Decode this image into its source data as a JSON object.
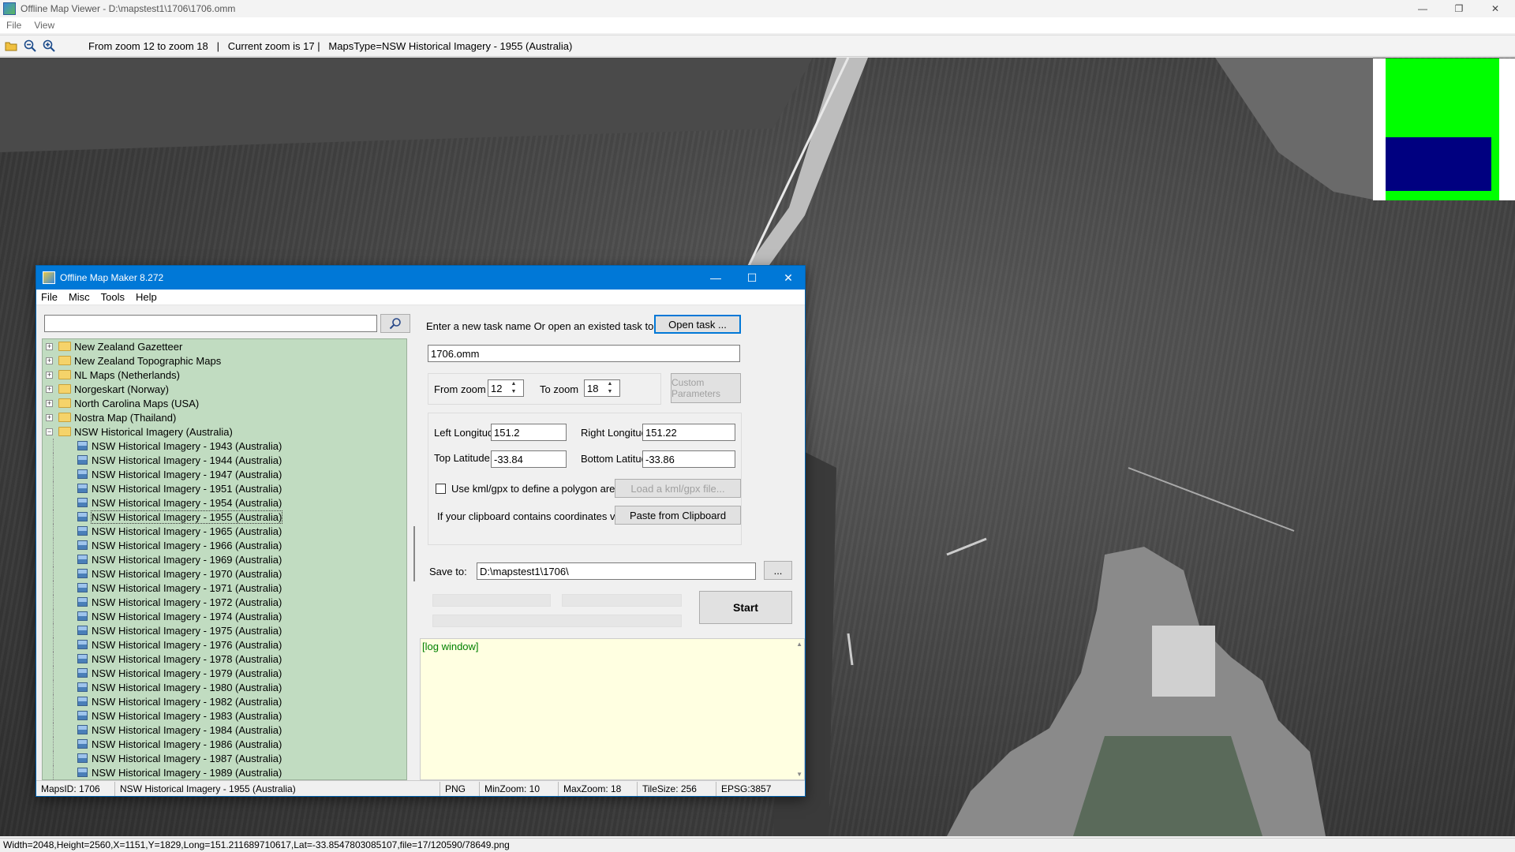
{
  "viewer": {
    "title": "Offline Map Viewer - D:\\mapstest1\\1706\\1706.omm",
    "menu": [
      "File",
      "View"
    ],
    "toolbar_info": "From zoom 12 to zoom 18   |   Current zoom is 17 |   MapsType=NSW Historical Imagery - 1955 (Australia)",
    "window_controls": {
      "minimize": "—",
      "restore": "❐",
      "close": "✕"
    },
    "status": "Width=2048,Height=2560,X=1151,Y=1829,Long=151.211689710617,Lat=-33.8547803085107,file=17/120590/78649.png"
  },
  "dialog": {
    "title": "Offline Map Maker 8.272",
    "menu": [
      "File",
      "Misc",
      "Tools",
      "Help"
    ],
    "search": {
      "value": "",
      "placeholder": ""
    },
    "tree": {
      "folders": [
        {
          "label": "New Zealand Gazetteer",
          "expander": "+"
        },
        {
          "label": "New Zealand Topographic Maps",
          "expander": "+"
        },
        {
          "label": "NL Maps (Netherlands)",
          "expander": "+"
        },
        {
          "label": "Norgeskart (Norway)",
          "expander": "+"
        },
        {
          "label": "North Carolina Maps (USA)",
          "expander": "+"
        },
        {
          "label": "Nostra Map (Thailand)",
          "expander": "+"
        },
        {
          "label": "NSW Historical Imagery (Australia)",
          "expander": "−"
        }
      ],
      "children": [
        "NSW Historical Imagery - 1943 (Australia)",
        "NSW Historical Imagery - 1944 (Australia)",
        "NSW Historical Imagery - 1947 (Australia)",
        "NSW Historical Imagery - 1951 (Australia)",
        "NSW Historical Imagery - 1954 (Australia)",
        "NSW Historical Imagery - 1955 (Australia)",
        "NSW Historical Imagery - 1965 (Australia)",
        "NSW Historical Imagery - 1966 (Australia)",
        "NSW Historical Imagery - 1969 (Australia)",
        "NSW Historical Imagery - 1970 (Australia)",
        "NSW Historical Imagery - 1971 (Australia)",
        "NSW Historical Imagery - 1972 (Australia)",
        "NSW Historical Imagery - 1974 (Australia)",
        "NSW Historical Imagery - 1975 (Australia)",
        "NSW Historical Imagery - 1976 (Australia)",
        "NSW Historical Imagery - 1978 (Australia)",
        "NSW Historical Imagery - 1979 (Australia)",
        "NSW Historical Imagery - 1980 (Australia)",
        "NSW Historical Imagery - 1982 (Australia)",
        "NSW Historical Imagery - 1983 (Australia)",
        "NSW Historical Imagery - 1984 (Australia)",
        "NSW Historical Imagery - 1986 (Australia)",
        "NSW Historical Imagery - 1987 (Australia)",
        "NSW Historical Imagery - 1989 (Australia)"
      ],
      "selected_child": "NSW Historical Imagery - 1955 (Australia)"
    },
    "task_prompt": "Enter a new task name Or open an existed task to continue:",
    "open_task_label": "Open task ...",
    "task_name": "1706.omm",
    "from_zoom_label": "From zoom",
    "from_zoom": "12",
    "to_zoom_label": "To zoom",
    "to_zoom": "18",
    "custom_params_label": "Custom Parameters",
    "left_lon_label": "Left Longitude",
    "left_lon": "151.2",
    "right_lon_label": "Right Longitude",
    "right_lon": "151.22",
    "top_lat_label": "Top Latitude",
    "top_lat": "-33.84",
    "bottom_lat_label": "Bottom Latitude",
    "bottom_lat": "-33.86",
    "kml_check_label": "Use kml/gpx to define a polygon area",
    "load_kml_label": "Load a kml/gpx file...",
    "clipboard_prompt": "If your clipboard contains coordinates values:",
    "paste_label": "Paste from Clipboard",
    "save_to_label": "Save to:",
    "save_to": "D:\\mapstest1\\1706\\",
    "browse_label": "...",
    "start_label": "Start",
    "log_text": "[log window]",
    "status": {
      "maps_id": "MapsID: 1706",
      "map_name": "NSW Historical Imagery - 1955 (Australia)",
      "format": "PNG",
      "min_zoom": "MinZoom: 10",
      "max_zoom": "MaxZoom: 18",
      "tile_size": "TileSize: 256",
      "epsg": "EPSG:3857"
    }
  },
  "colors": {
    "tree_bg": "#c1dcc1",
    "titlebar": "#0078d7",
    "log_bg": "#ffffe1",
    "minimap_green": "#00ff00",
    "minimap_blue": "#000080"
  }
}
